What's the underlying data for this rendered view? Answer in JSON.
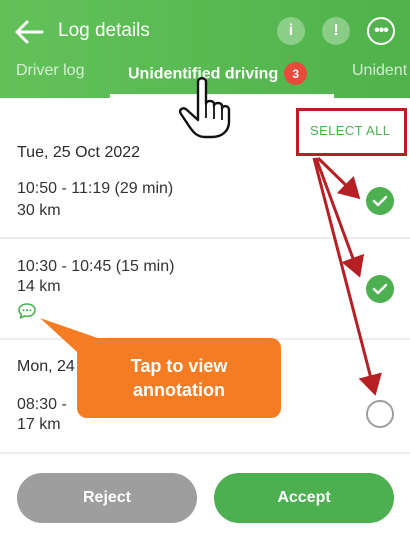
{
  "header": {
    "title": "Log details",
    "info_glyph": "i",
    "alert_glyph": "!",
    "more_glyph": "•••",
    "background_color": "#56b94f"
  },
  "tabs": [
    {
      "label": "Driver log"
    },
    {
      "label": "Unidentified driving",
      "badge": "3",
      "active": true
    },
    {
      "label": "Unident"
    }
  ],
  "actions": {
    "select_all": "SELECT ALL"
  },
  "entries": [
    {
      "date": "Tue, 25 Oct 2022",
      "time": "10:50 - 11:19 (29 min)",
      "distance": "30 km",
      "selected": true
    },
    {
      "time": "10:30 - 10:45 (15 min)",
      "distance": "14 km",
      "selected": true,
      "has_annotation": true
    },
    {
      "date": "Mon, 24",
      "time": "08:30 -",
      "distance": "17 km",
      "selected": false
    }
  ],
  "callout": {
    "line1": "Tap to view",
    "line2": "annotation",
    "color": "#f57c23"
  },
  "buttons": {
    "reject": "Reject",
    "accept": "Accept"
  },
  "colors": {
    "accent": "#4caf50",
    "annotation_red": "#b61f24",
    "badge": "#e84b3c"
  },
  "icons": [
    "back-arrow-icon",
    "info-icon",
    "alert-icon",
    "more-icon",
    "check-icon",
    "comment-icon",
    "hand-pointer-icon"
  ]
}
